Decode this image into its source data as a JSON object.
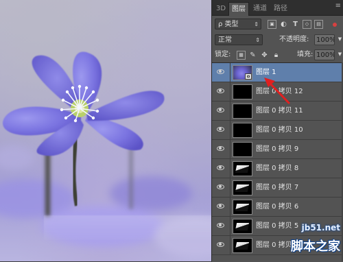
{
  "panel_tabs": [
    {
      "label": "3D"
    },
    {
      "label": "图层"
    },
    {
      "label": "通道"
    },
    {
      "label": "路径"
    }
  ],
  "filter": {
    "kind_label": "ρ 类型",
    "icons": [
      "image-filter-icon",
      "adjustment-filter-icon",
      "type-filter-icon",
      "shape-filter-icon",
      "smart-object-filter-icon"
    ]
  },
  "blend": {
    "mode": "正常",
    "opacity_label": "不透明度:",
    "opacity_value": "100%"
  },
  "lock": {
    "label": "锁定:",
    "fill_label": "填充:",
    "fill_value": "100%"
  },
  "layers": [
    {
      "name": "图层 1",
      "thumb": "photo",
      "selected": true,
      "smart": true
    },
    {
      "name": "图层 0 拷贝 12",
      "thumb": "black"
    },
    {
      "name": "图层 0 拷贝 11",
      "thumb": "black"
    },
    {
      "name": "图层 0 拷贝 10",
      "thumb": "black"
    },
    {
      "name": "图层 0 拷贝 9",
      "thumb": "black"
    },
    {
      "name": "图层 0 拷贝 8",
      "thumb": "pic"
    },
    {
      "name": "图层 0 拷贝 7",
      "thumb": "pic"
    },
    {
      "name": "图层 0 拷贝 6",
      "thumb": "pic"
    },
    {
      "name": "图层 0 拷贝 5",
      "thumb": "pic"
    },
    {
      "name": "图层 0 拷贝 4",
      "thumb": "pic"
    }
  ],
  "watermark": {
    "url": "jb51.net",
    "name": "脚本之家"
  },
  "colors": {
    "panel_bg": "#535353",
    "selected_layer": "#5f7fab",
    "arrow": "#e02020",
    "flower": "#6b63d1"
  }
}
